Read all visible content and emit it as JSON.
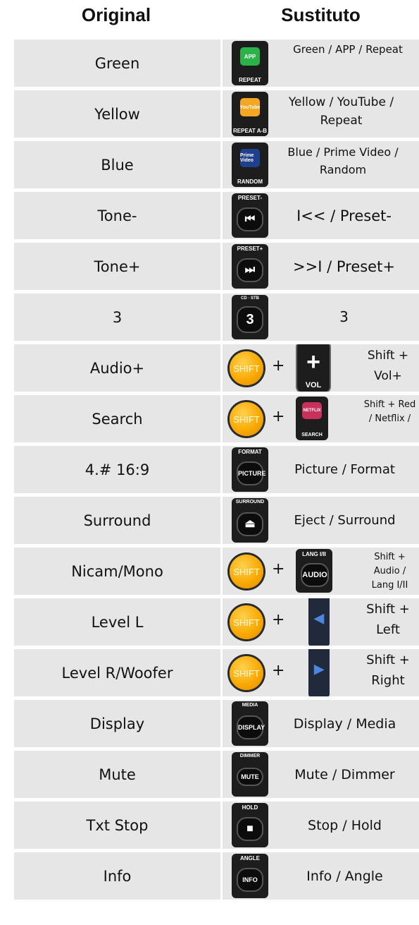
{
  "header": {
    "original": "Original",
    "sustituto": "Sustituto"
  },
  "rows": [
    {
      "original": "Green",
      "key": {
        "top": "",
        "center": "APP",
        "bottom": "REPEAT",
        "icon": "app-key-icon"
      },
      "desc": "Green / APP / Repeat"
    },
    {
      "original": "Yellow",
      "key": {
        "top": "",
        "center": "YouTube",
        "bottom": "REPEAT A-B",
        "icon": "youtube-key-icon"
      },
      "desc": "Yellow / YouTube / Repeat"
    },
    {
      "original": "Blue",
      "key": {
        "top": "",
        "center": "Prime Video",
        "bottom": "RANDOM",
        "icon": "prime-video-key-icon"
      },
      "desc": "Blue / Prime Video / Random"
    },
    {
      "original": "Tone-",
      "key": {
        "top": "PRESET-",
        "center": "⏮",
        "bottom": "",
        "icon": "previous-track-icon"
      },
      "desc": "I<< / Preset-"
    },
    {
      "original": "Tone+",
      "key": {
        "top": "PRESET+",
        "center": "⏭",
        "bottom": "",
        "icon": "next-track-icon"
      },
      "desc": ">>I / Preset+"
    },
    {
      "original": "3",
      "key": {
        "top": "CD · STB",
        "center": "3",
        "bottom": "",
        "icon": "number-3-key-icon"
      },
      "desc": "3"
    },
    {
      "original": "Audio+",
      "key": {
        "top": "SHIFT",
        "center": "+",
        "bottom": "VOL",
        "icon": "volume-up-key-icon"
      },
      "desc": "Shift + Vol+"
    },
    {
      "original": "Search",
      "key": {
        "top": "SHIFT",
        "center": "NETFLIX",
        "bottom": "SEARCH",
        "icon": "netflix-key-icon"
      },
      "desc": "Shift + Red / Netflix /"
    },
    {
      "original": "4.# 16:9",
      "key": {
        "top": "FORMAT",
        "center": "PICTURE",
        "bottom": "",
        "icon": "picture-key-icon"
      },
      "desc": "Picture / Format"
    },
    {
      "original": "Surround",
      "key": {
        "top": "SURROUND",
        "center": "⏏",
        "bottom": "",
        "icon": "eject-key-icon"
      },
      "desc": "Eject / Surround"
    },
    {
      "original": "Nicam/Mono",
      "key": {
        "top": "SHIFT",
        "center": "AUDIO",
        "bottom": "LANG I/II",
        "icon": "audio-key-icon"
      },
      "desc": "Shift + Audio / Lang I/II"
    },
    {
      "original": "Level L",
      "key": {
        "top": "SHIFT",
        "center": "◀",
        "bottom": "",
        "icon": "left-arrow-key-icon"
      },
      "desc": "Shift + Left"
    },
    {
      "original": "Level R/Woofer",
      "key": {
        "top": "SHIFT",
        "center": "▶",
        "bottom": "",
        "icon": "right-arrow-key-icon"
      },
      "desc": "Shift + Right"
    },
    {
      "original": "Display",
      "key": {
        "top": "MEDIA",
        "center": "DISPLAY",
        "bottom": "",
        "icon": "display-key-icon"
      },
      "desc": "Display / Media"
    },
    {
      "original": "Mute",
      "key": {
        "top": "DIMMER",
        "center": "MUTE",
        "bottom": "",
        "icon": "mute-key-icon"
      },
      "desc": "Mute / Dimmer"
    },
    {
      "original": "Txt Stop",
      "key": {
        "top": "HOLD",
        "center": "■",
        "bottom": "",
        "icon": "stop-key-icon"
      },
      "desc": "Stop / Hold"
    },
    {
      "original": "Info",
      "key": {
        "top": "ANGLE",
        "center": "INFO",
        "bottom": "",
        "icon": "info-key-icon"
      },
      "desc": "Info / Angle"
    }
  ]
}
